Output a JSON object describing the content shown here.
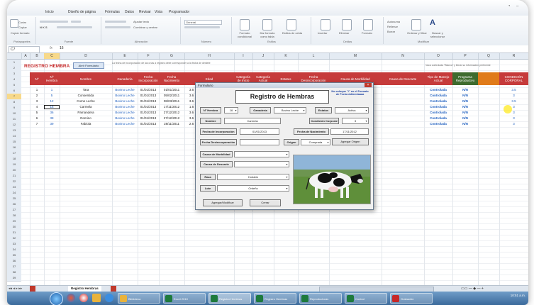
{
  "menu": [
    "Inicio",
    "Diseño de página",
    "Fórmulas",
    "Datos",
    "Revisar",
    "Vista",
    "Programador"
  ],
  "ribbon": {
    "groups": [
      "Portapapeles",
      "Fuente",
      "Alineación",
      "Número",
      "Estilos",
      "Celdas",
      "Modificar"
    ],
    "items": [
      "Cortar",
      "Copiar",
      "Copiar formato",
      "Ajustar texto",
      "Combinar y centrar",
      "General",
      "Formato condicional",
      "Dar formato como tabla",
      "Estilos de celda",
      "Insertar",
      "Eliminar",
      "Formato",
      "Autosuma",
      "Rellenar",
      "Borrar",
      "Ordenar y filtrar",
      "Buscar y seleccionar"
    ]
  },
  "formula_bar": {
    "name_box": "C7",
    "fx": "fx",
    "value": "16"
  },
  "columns": [
    "A",
    "B",
    "C",
    "D",
    "E",
    "F",
    "G",
    "H",
    "I",
    "J",
    "K",
    "L",
    "M",
    "N",
    "O",
    "P",
    "Q",
    "R"
  ],
  "selected_column": "C",
  "selected_row": "7",
  "rows": [
    "1",
    "2",
    "3",
    "4",
    "5",
    "6",
    "7",
    "8",
    "9",
    "10",
    "11",
    "12",
    "13",
    "14",
    "15",
    "16",
    "17",
    "18",
    "19",
    "20",
    "21",
    "22",
    "23",
    "24",
    "25",
    "26",
    "27",
    "28",
    "29",
    "30",
    "31",
    "32",
    "33",
    "34",
    "35",
    "36",
    "37",
    "38",
    "39"
  ],
  "sheet": {
    "title": "REGISTRO HEMBRA",
    "button": "Abrir Formulario",
    "note_left": "La fecha de incorporación de las crías a registro debe corresponder a la fecha de destete",
    "note_right": "Vaca controlada \"Blanca\" y llenar su información pertinente",
    "headers": [
      "Nº",
      "Nº Hembra",
      "Nombre",
      "Ganadería",
      "Fecha Incorporación",
      "Fecha Nacimiento",
      "Edad",
      "Categoría de Inicio",
      "Categoría Actual",
      "Estatus",
      "Fecha Desincorporación",
      "Causa de Morbilidad",
      "Causa de Descarte",
      "Tipo de Manejo Actual",
      "Programa Reproductivo",
      "",
      "CONDICIÓN CORPORAL"
    ],
    "rows": [
      [
        "1",
        "1",
        "Tara",
        "Bovino Leche",
        "01/01/2013",
        "01/01/2011",
        "3.6",
        "Controlada",
        "N/N",
        "",
        "3.5"
      ],
      [
        "2",
        "5",
        "Consentida",
        "Bovino Leche",
        "01/01/2013",
        "05/02/2011",
        "3.6",
        "Controlada",
        "N/N",
        "",
        "3"
      ],
      [
        "3",
        "12",
        "Come Leche",
        "Bovino Leche",
        "01/01/2013",
        "08/03/2011",
        "3.6",
        "Controlada",
        "N/N",
        "",
        "3.5"
      ],
      [
        "4",
        "16",
        "Carmela",
        "Bovino Leche",
        "01/01/2013",
        "17/11/2012",
        "1.6",
        "Controlada",
        "N/N",
        "",
        "3"
      ],
      [
        "5",
        "36",
        "Pamandera",
        "Bovino Leche",
        "01/01/2013",
        "27/12/2012",
        "3.6",
        "Controlada",
        "N/N",
        "",
        "3"
      ],
      [
        "6",
        "38",
        "Domino",
        "Bovino Leche",
        "01/01/2013",
        "27/12/2012",
        "3.6",
        "Controlada",
        "N/N",
        "",
        "3"
      ],
      [
        "7",
        "39",
        "Fabiola",
        "Bovino Leche",
        "01/01/2013",
        "28/11/2011",
        "2.6",
        "Controlada",
        "N/N",
        "",
        "3"
      ]
    ]
  },
  "form": {
    "window_title": "Formulario",
    "heading": "Registro de Hembras",
    "help": "No coloque \"/\" en el Formato de Fecha dd/mm/aaaa",
    "lbl_numero": "Nº Hembra",
    "val_numero": "16",
    "lbl_ganaderia": "Ganadería",
    "val_ganaderia": "Bovino Leche",
    "lbl_estatus": "Estatus",
    "val_estatus": "Activa",
    "lbl_nombre": "Nombre",
    "val_nombre": "Carmela",
    "lbl_condicion": "Condición Corporal",
    "val_condicion": "3",
    "lbl_incorporacion": "Fecha de Incorporación",
    "val_incorporacion": "01/01/2013",
    "lbl_nacimiento": "Fecha de Nacimiento",
    "val_nacimiento": "17/11/2012",
    "lbl_desincorporacion": "Fecha Desincorporación",
    "val_desincorporacion": "",
    "lbl_origen": "Origen",
    "val_origen": "Comprada",
    "btn_origen": "Agregar Origen",
    "lbl_morbilidad": "Causa de Morbilidad",
    "lbl_descarte": "Causa de Descarte",
    "lbl_raza": "Raza",
    "val_raza": "Holstein",
    "lbl_lote": "Lote",
    "val_lote": "Ordeño",
    "btn_agregar": "Agregar/Modificar",
    "btn_cerrar": "Cerrar"
  },
  "tabs": [
    "Registro Hembras"
  ],
  "taskbar": [
    "Biblioteca",
    "Excel 2010",
    "Registro Hembras",
    "Registro Hembras",
    "Reproductoras",
    "Control",
    "Grabación"
  ],
  "tray_time": "10:51 a.m."
}
